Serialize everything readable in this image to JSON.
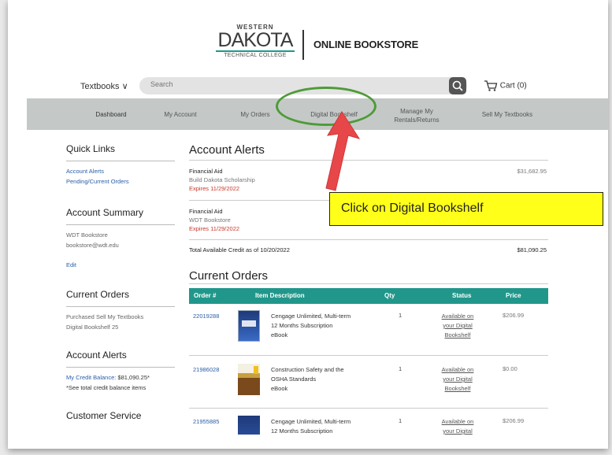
{
  "header": {
    "logo_top": "WESTERN",
    "logo_main": "DAKOTA",
    "logo_sub": "TECHNICAL COLLEGE",
    "store_title": "ONLINE BOOKSTORE"
  },
  "search": {
    "dropdown_label": "Textbooks ∨",
    "placeholder": "Search",
    "cart_label": "Cart (0)"
  },
  "nav": {
    "items": [
      "Dashboard",
      "My Account",
      "My Orders",
      "Digital Bookshelf",
      "Manage My Rentals/Returns",
      "Sell My Textbooks"
    ]
  },
  "sidebar": {
    "quick_links_title": "Quick Links",
    "quick_links": [
      "Account Alerts",
      "Pending/Current Orders"
    ],
    "account_summary_title": "Account Summary",
    "account_summary_lines": [
      "WDT Bookstore",
      "bookstore@wdt.edu"
    ],
    "edit_label": "Edit",
    "current_orders_title": "Current Orders",
    "current_orders_lines": [
      "Purchased  Sell My Textbooks",
      "Digital Bookshelf  25"
    ],
    "account_alerts_title": "Account Alerts",
    "credit_balance_label": "My Credit Balance:",
    "credit_balance_value": "$81,090.25*",
    "credit_note": "*See total credit balance items",
    "customer_service_title": "Customer Service"
  },
  "main": {
    "alerts_title": "Account Alerts",
    "alerts": [
      {
        "name": "Financial Aid",
        "source": "Build Dakota Scholarship",
        "expires": "Expires 11/29/2022",
        "amount": "$31,682.95"
      },
      {
        "name": "Financial Aid",
        "source": "WDT Bookstore",
        "expires": "Expires 11/29/2022",
        "amount": ""
      }
    ],
    "total_label": "Total Available Credit as of 10/20/2022",
    "total_value": "$81,090.25",
    "orders_title": "Current Orders",
    "orders_columns": [
      "Order #",
      "Item Description",
      "Qty",
      "Status",
      "Price"
    ],
    "orders": [
      {
        "order_no": "22019288",
        "desc_line1": "Cengage Unlimited, Multi-term",
        "desc_line2": "12 Months Subscription",
        "desc_line3": "eBook",
        "qty": "1",
        "status_line1": "Available on",
        "status_line2": "your Digital",
        "status_line3": "Bookshelf",
        "price": "$206.99"
      },
      {
        "order_no": "21986028",
        "desc_line1": "Construction Safety and the",
        "desc_line2": "OSHA Standards",
        "desc_line3": "eBook",
        "qty": "1",
        "status_line1": "Available on",
        "status_line2": "your Digital",
        "status_line3": "Bookshelf",
        "price": "$0.00"
      },
      {
        "order_no": "21955885",
        "desc_line1": "Cengage Unlimited, Multi-term",
        "desc_line2": "12 Months Subscription",
        "desc_line3": "",
        "qty": "1",
        "status_line1": "Available on",
        "status_line2": "your Digital",
        "status_line3": "",
        "price": "$206.99"
      }
    ]
  },
  "callout": {
    "text": "Click on Digital Bookshelf",
    "ellipse_color": "#4e9b38",
    "arrow_color": "#e8474a",
    "box_color": "#ffff1a"
  }
}
